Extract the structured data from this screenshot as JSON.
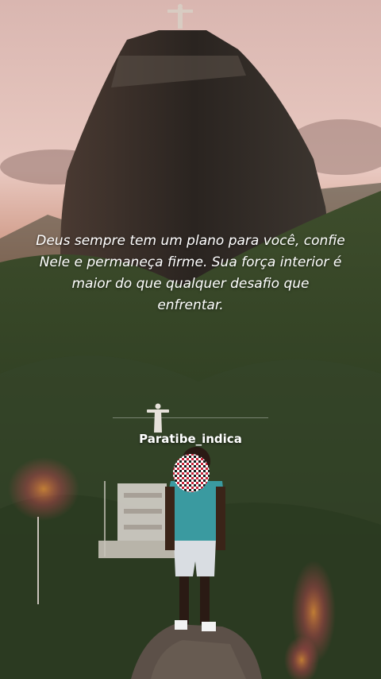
{
  "quote": {
    "lines": [
      "Deus sempre tem um plano para você, confie",
      "Nele e permaneça firme. Sua força interior é",
      "maior do que qualquer desafio que",
      "enfrentar."
    ]
  },
  "watermark": {
    "username": "Paratibe_indica",
    "logo_icon": "christ-the-redeemer-icon"
  },
  "colors": {
    "sky": "#e9c9c1",
    "mountain": "#2c2622",
    "forest": "#3b4a2a",
    "shirt": "#3a9aa0",
    "text": "#ffffff"
  },
  "icons": [
    "christ-the-redeemer-icon",
    "face-blur-icon"
  ]
}
